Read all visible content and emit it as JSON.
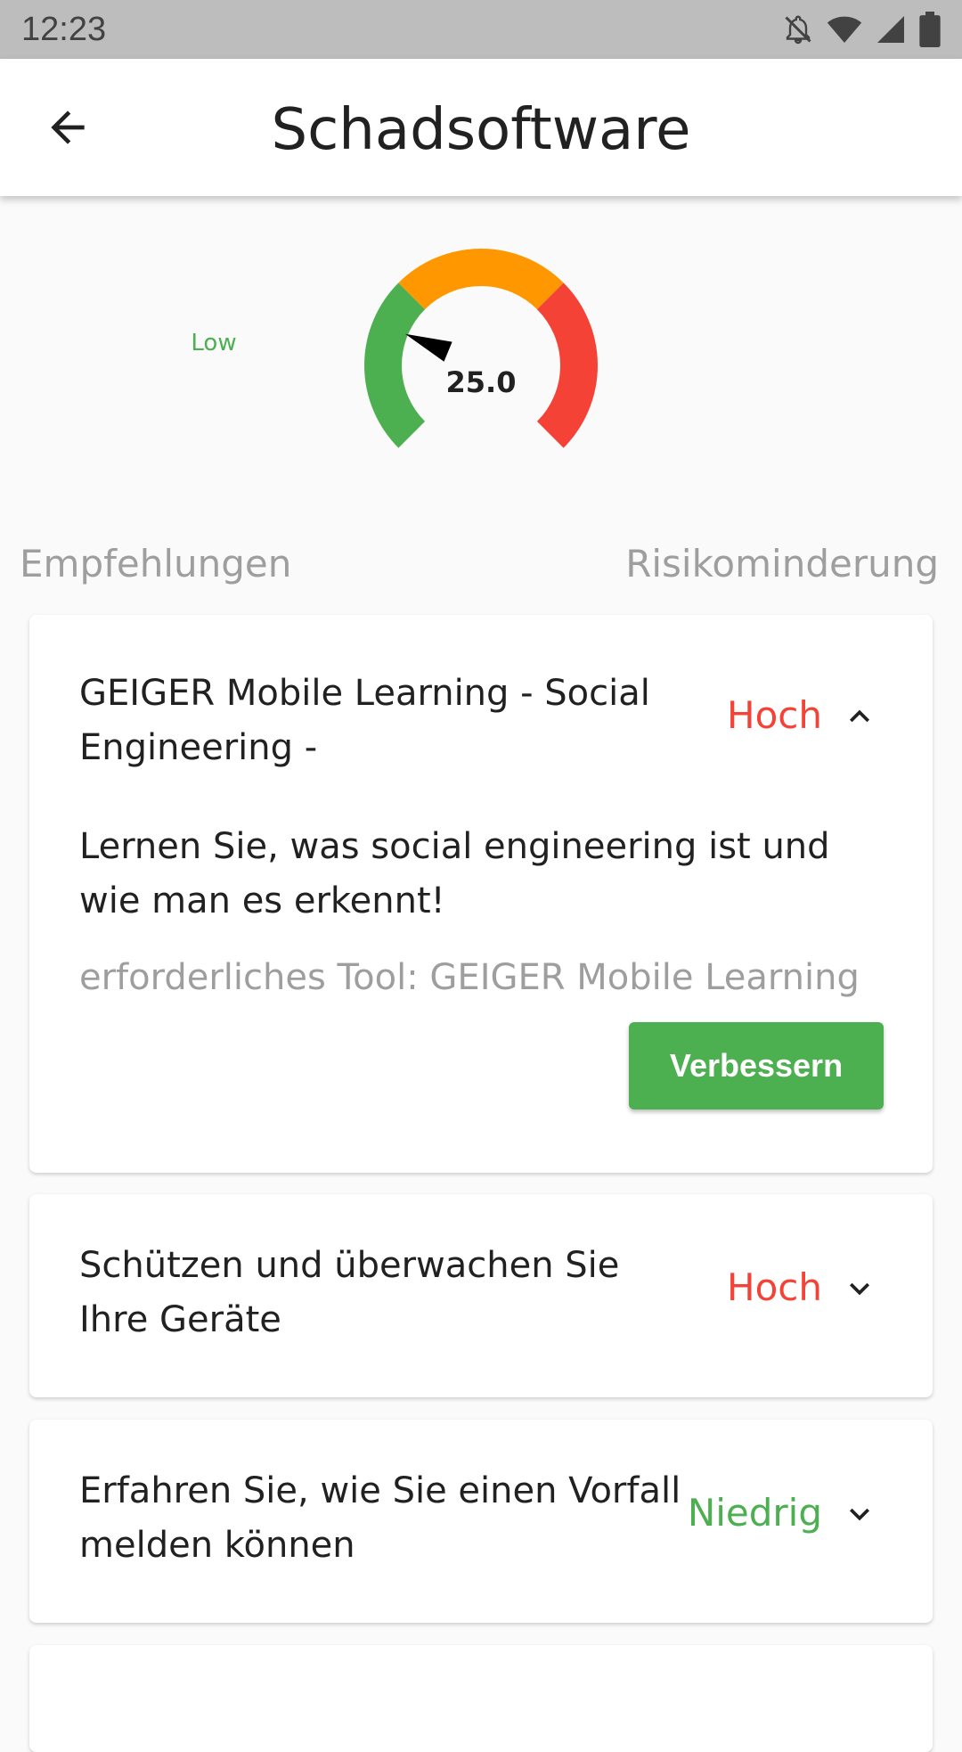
{
  "status_bar": {
    "time": "12:23",
    "icons": [
      "notifications-off-icon",
      "wifi-icon",
      "signal-icon",
      "battery-icon"
    ]
  },
  "app_bar": {
    "title": "Schadsoftware",
    "back_icon": "arrow-back-icon"
  },
  "gauge": {
    "level_label": "Low",
    "value": "25.0",
    "value_number": 25.0,
    "range": [
      0,
      100
    ],
    "segment_colors": {
      "low": "#4caf50",
      "medium": "#ff9800",
      "high": "#f44336"
    }
  },
  "sections": {
    "left": "Empfehlungen",
    "right": "Risikominderung"
  },
  "recommendations": [
    {
      "title": "GEIGER Mobile Learning - Social Engineering -",
      "risk": "Hoch",
      "expanded": true,
      "description": "Lernen Sie, was social engineering ist und wie man es erkennt!",
      "tool": "erforderliches Tool: GEIGER Mobile Learning",
      "button_label": "Verbessern"
    },
    {
      "title": "Schützen und überwachen Sie Ihre Geräte",
      "risk": "Hoch",
      "expanded": false
    },
    {
      "title": "Erfahren Sie, wie Sie einen Vorfall melden können",
      "risk": "Niedrig",
      "expanded": false
    }
  ],
  "colors": {
    "risk_high": "#f44336",
    "risk_low": "#4caf50",
    "button": "#4caf50"
  }
}
